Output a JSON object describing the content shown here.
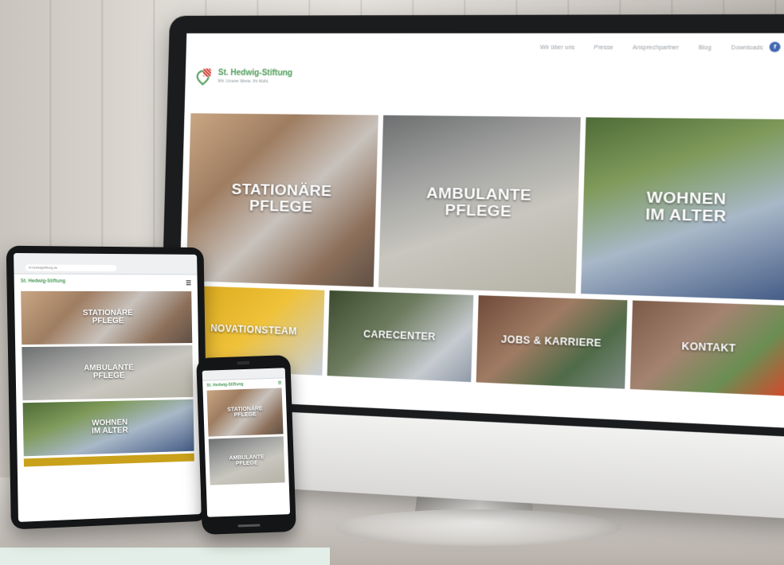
{
  "nav": {
    "items": [
      "Wir über uns",
      "Presse",
      "Ansprechpartner",
      "Blog",
      "Downloads"
    ]
  },
  "social": {
    "facebook": "f",
    "instagram": "◎"
  },
  "brand": {
    "name": "St. Hedwig-Stiftung",
    "tagline": "Wir. Unsere Werte. Ihr Wohl.",
    "green": "#4c9a57",
    "red": "#d4463f"
  },
  "tiles": {
    "stationaer": "STATIONÄRE\nPFLEGE",
    "ambulant": "AMBULANTE\nPFLEGE",
    "wohnen": "WOHNEN\nIM ALTER",
    "innovation": "NOVATIONSTEAM",
    "carecenter": "CARECENTER",
    "jobs": "JOBS & KARRIERE",
    "kontakt": "KONTAKT"
  },
  "tablet": {
    "url": "st-hedwigstiftung.de",
    "logo": "St. Hedwig-Stiftung",
    "menu": "☰",
    "tiles": [
      "STATIONÄRE\nPFLEGE",
      "AMBULANTE\nPFLEGE",
      "WOHNEN\nIM ALTER"
    ]
  },
  "phone": {
    "logo": "St. Hedwig-Stiftung",
    "menu": "☰",
    "tiles": [
      "STATIONÄRE\nPFLEGE",
      "AMBULANTE\nPFLEGE"
    ]
  }
}
